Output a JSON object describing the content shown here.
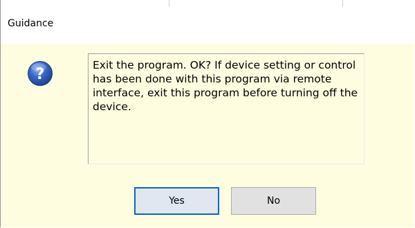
{
  "window": {
    "title": "Guidance"
  },
  "dialog": {
    "icon": "question-icon",
    "message": "Exit the program. OK? If device setting or control has been done with this program via remote interface, exit this program before turning off the device."
  },
  "buttons": {
    "yes_label": "Yes",
    "no_label": "No"
  },
  "colors": {
    "dialog_background": "#fffde0",
    "titlebar_background": "#ffffff",
    "default_button_border": "#0a64c8",
    "icon_blue": "#1f4fa8"
  }
}
